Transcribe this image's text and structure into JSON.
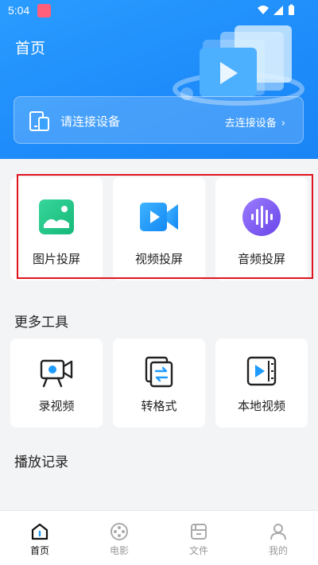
{
  "status_bar": {
    "time": "5:04"
  },
  "header": {
    "title": "首页",
    "device_banner": {
      "label": "请连接设备",
      "link": "去连接设备",
      "chevron": "›"
    }
  },
  "cast": {
    "items": [
      {
        "label": "图片投屏",
        "icon": "image-icon"
      },
      {
        "label": "视频投屏",
        "icon": "video-camera-icon"
      },
      {
        "label": "音频投屏",
        "icon": "audio-wave-icon"
      }
    ]
  },
  "tools": {
    "title": "更多工具",
    "items": [
      {
        "label": "录视频",
        "icon": "record-camera-icon"
      },
      {
        "label": "转格式",
        "icon": "convert-icon"
      },
      {
        "label": "本地视频",
        "icon": "local-video-icon"
      }
    ]
  },
  "history": {
    "title": "播放记录"
  },
  "nav": {
    "items": [
      {
        "label": "首页",
        "active": true
      },
      {
        "label": "电影",
        "active": false
      },
      {
        "label": "文件",
        "active": false
      },
      {
        "label": "我的",
        "active": false
      }
    ]
  },
  "colors": {
    "header_blue": "#1e8cfa",
    "image_icon_green": "#2ec98a",
    "video_icon_blue": "#1e9bff",
    "audio_icon_purple": "#7c5cf0",
    "highlight_red": "#e0141e"
  }
}
